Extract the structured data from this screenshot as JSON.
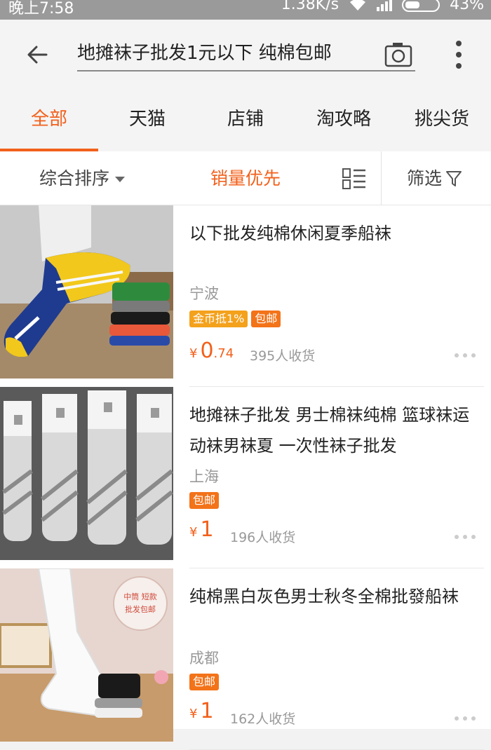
{
  "status_bar": {
    "time": "晚上7:58",
    "speed": "1.38K/s",
    "battery": "43%"
  },
  "search": {
    "query": "地摊袜子批发1元以下 纯棉包邮",
    "icons": [
      "back-arrow-icon",
      "camera-icon",
      "more-vertical-icon"
    ]
  },
  "tabs": [
    {
      "label": "全部",
      "active": true
    },
    {
      "label": "天猫"
    },
    {
      "label": "店铺"
    },
    {
      "label": "淘攻略"
    },
    {
      "label": "挑尖货"
    }
  ],
  "sort": {
    "default_label": "综合排序",
    "sales_label": "销量优先",
    "filter_label": "筛选"
  },
  "colors": {
    "accent": "#f2601b",
    "badge_orange": "#f37319",
    "badge_gold": "#f4a11c"
  },
  "products": [
    {
      "title": "以下批发纯棉休闲夏季船袜",
      "location": "宁波",
      "badges": [
        "金币抵1%",
        "包邮"
      ],
      "price_int": "0",
      "price_dec": ".74",
      "sold": "395人收货"
    },
    {
      "title": "地摊袜子批发 男士棉袜纯棉 篮球袜运动袜男袜夏 一次性袜子批发",
      "location": "上海",
      "badges": [
        "包邮"
      ],
      "price_int": "1",
      "price_dec": "",
      "sold": "196人收货"
    },
    {
      "title": "纯棉黑白灰色男士秋冬全棉批發船袜",
      "location": "成都",
      "badges": [
        "包邮"
      ],
      "price_int": "1",
      "price_dec": "",
      "sold": "162人收货",
      "thumb_texts": [
        "中筒 短款",
        "批发包邮"
      ]
    }
  ],
  "currency": "¥"
}
